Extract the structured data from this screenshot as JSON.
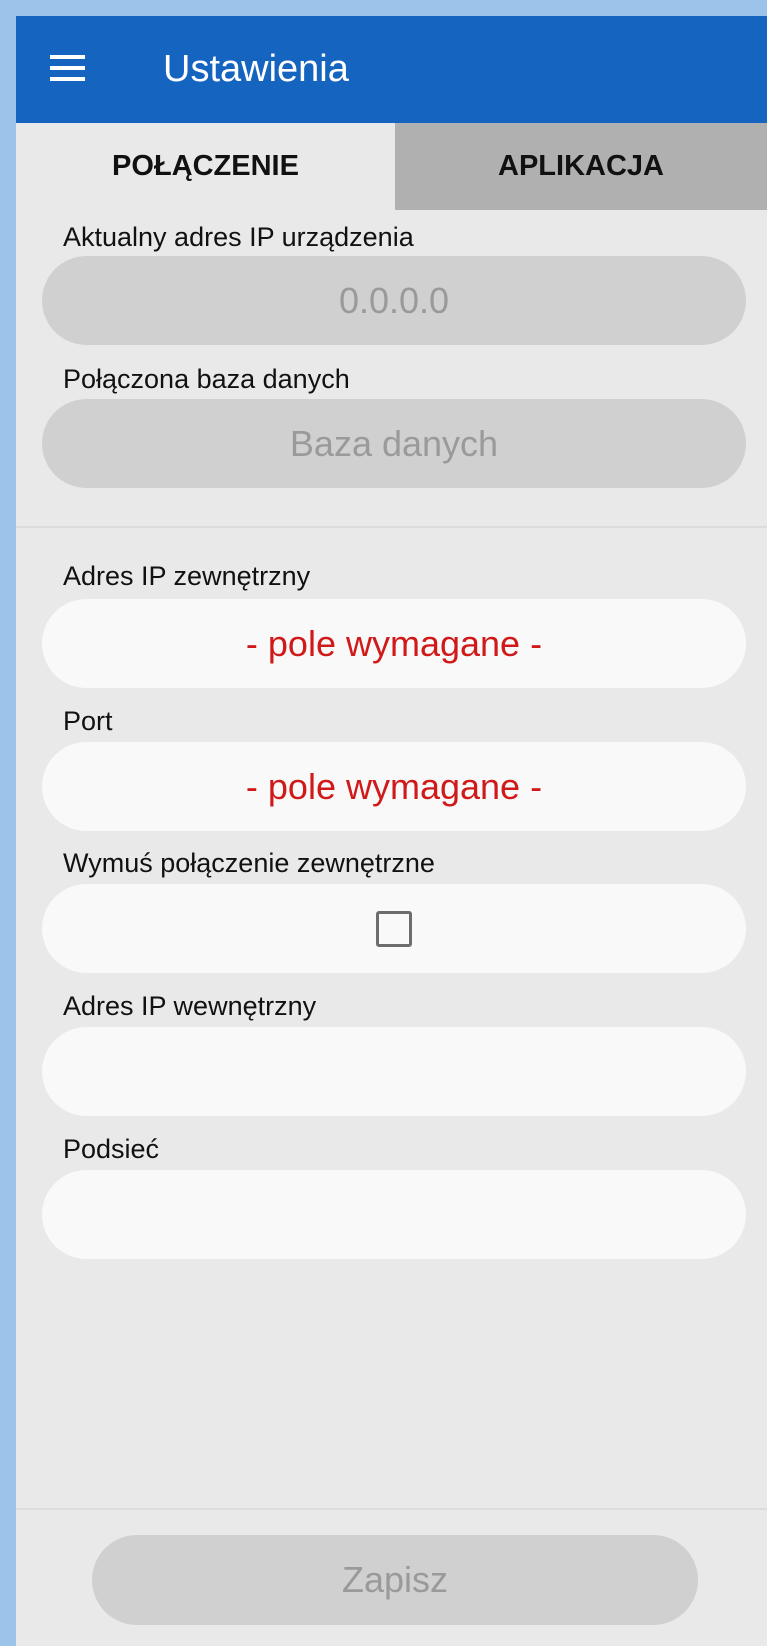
{
  "appbar": {
    "title": "Ustawienia",
    "menu_icon": "hamburger-menu-icon",
    "color": "#1565c0"
  },
  "tabs": [
    {
      "label": "POŁĄCZENIE",
      "active": true
    },
    {
      "label": "APLIKACJA",
      "active": false
    }
  ],
  "current": {
    "ip_label": "Aktualny adres IP urządzenia",
    "ip_value": "0.0.0.0",
    "db_label": "Połączona baza danych",
    "db_value": "Baza danych"
  },
  "form": {
    "external_ip_label": "Adres IP zewnętrzny",
    "external_ip_placeholder": "- pole wymagane -",
    "port_label": "Port",
    "port_placeholder": "- pole wymagane -",
    "force_external_label": "Wymuś połączenie zewnętrzne",
    "force_external_checked": false,
    "internal_ip_label": "Adres IP wewnętrzny",
    "internal_ip_value": "",
    "subnet_label": "Podsieć",
    "subnet_value": ""
  },
  "footer": {
    "save_label": "Zapisz"
  },
  "colors": {
    "required_text": "#d01a1a",
    "disabled_text": "#9a9a9a"
  }
}
